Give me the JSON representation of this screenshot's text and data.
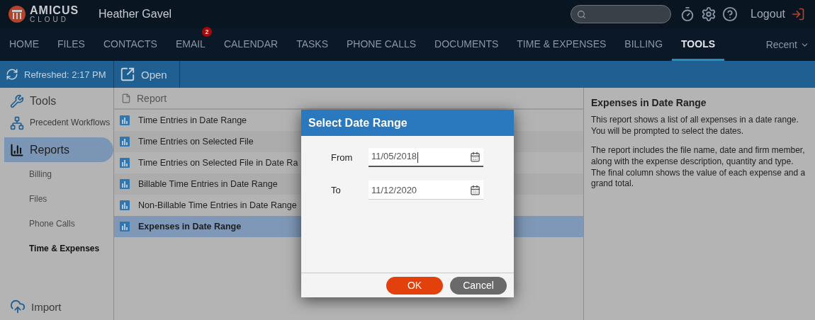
{
  "header": {
    "logo": {
      "name": "AMICUS",
      "sub": "CLOUD"
    },
    "user": "Heather Gavel",
    "logout": "Logout"
  },
  "nav": {
    "items": [
      {
        "label": "HOME",
        "selected": false
      },
      {
        "label": "FILES",
        "selected": false
      },
      {
        "label": "CONTACTS",
        "selected": false
      },
      {
        "label": "EMAIL",
        "selected": false,
        "badge": "2"
      },
      {
        "label": "CALENDAR",
        "selected": false
      },
      {
        "label": "TASKS",
        "selected": false
      },
      {
        "label": "PHONE CALLS",
        "selected": false
      },
      {
        "label": "DOCUMENTS",
        "selected": false
      },
      {
        "label": "TIME & EXPENSES",
        "selected": false
      },
      {
        "label": "BILLING",
        "selected": false
      },
      {
        "label": "TOOLS",
        "selected": true
      }
    ],
    "recent": "Recent"
  },
  "toolbar": {
    "refreshed": "Refreshed: 2:17 PM",
    "open": "Open"
  },
  "sidebar": {
    "title": "Tools",
    "items": [
      {
        "kind": "workflows",
        "label": "Precedent Workflows",
        "selected": false
      },
      {
        "kind": "reports",
        "label": "Reports",
        "selected": true,
        "children": [
          {
            "label": "Billing",
            "selected": false
          },
          {
            "label": "Files",
            "selected": false
          },
          {
            "label": "Phone Calls",
            "selected": false
          },
          {
            "label": "Time & Expenses",
            "selected": true
          }
        ]
      }
    ],
    "import": "Import"
  },
  "report_list": {
    "column": "Report",
    "rows": [
      {
        "label": "Time Entries in Date Range",
        "selected": false
      },
      {
        "label": "Time Entries on Selected File",
        "selected": false
      },
      {
        "label": "Time Entries on Selected File in Date Ra",
        "selected": false
      },
      {
        "label": "Billable Time Entries in Date Range",
        "selected": false
      },
      {
        "label": "Non-Billable Time Entries in Date Range",
        "selected": false
      },
      {
        "label": "Expenses in Date Range",
        "selected": true
      }
    ]
  },
  "details": {
    "title": "Expenses in Date Range",
    "paragraphs": [
      "This report shows a list of all expenses in a date range. You will be prompted to select the dates.",
      "The report includes the file name, date and firm member, along with the expense description, quantity and type. The final column shows the value of each expense and a grand total."
    ]
  },
  "dialog": {
    "title": "Select Date Range",
    "fields": [
      {
        "label": "From",
        "value": "11/05/2018",
        "focused": true
      },
      {
        "label": "To",
        "value": "11/12/2020",
        "focused": false
      }
    ],
    "buttons": [
      {
        "label": "OK",
        "kind": "primary"
      },
      {
        "label": "Cancel",
        "kind": "secondary"
      }
    ]
  }
}
